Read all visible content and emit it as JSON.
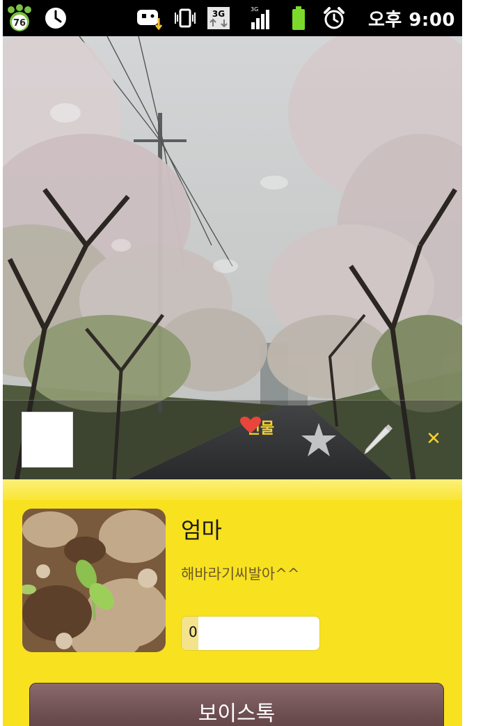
{
  "status_bar": {
    "battery_badge": "76",
    "signal_label": "3G",
    "time": "오후 9:00"
  },
  "cover_actions": {
    "gift_label": "선물"
  },
  "profile": {
    "name": "엄마",
    "status_message": "해바라기씨발아^^",
    "count_value": "0"
  },
  "buttons": {
    "voicetalk_label": "보이스톡"
  },
  "colors": {
    "panel_yellow": "#f8e11f",
    "accent_yellow": "#f5d22a",
    "gift_heart": "#e8453c",
    "voicetalk_brown": "#6b4c4f"
  }
}
